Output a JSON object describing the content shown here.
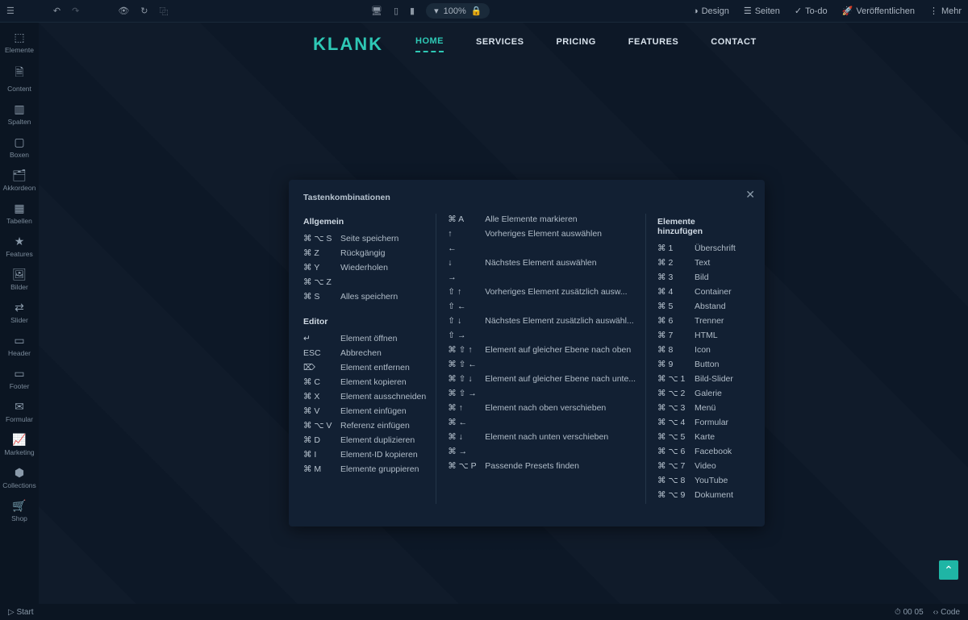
{
  "topbar": {
    "zoom": "100%",
    "design": "Design",
    "seiten": "Seiten",
    "todo": "To-do",
    "publish": "Veröffentlichen",
    "more": "Mehr"
  },
  "sidebar": [
    {
      "icon": "⬚",
      "label": "Elemente"
    },
    {
      "icon": "🗎",
      "label": "Content"
    },
    {
      "icon": "▥",
      "label": "Spalten"
    },
    {
      "icon": "▢",
      "label": "Boxen"
    },
    {
      "icon": "🗂",
      "label": "Akkordeon"
    },
    {
      "icon": "▦",
      "label": "Tabellen"
    },
    {
      "icon": "★",
      "label": "Features"
    },
    {
      "icon": "🖼",
      "label": "Bilder"
    },
    {
      "icon": "⇄",
      "label": "Slider"
    },
    {
      "icon": "▭",
      "label": "Header"
    },
    {
      "icon": "▭",
      "label": "Footer"
    },
    {
      "icon": "✉",
      "label": "Formular"
    },
    {
      "icon": "📈",
      "label": "Marketing"
    },
    {
      "icon": "⬢",
      "label": "Collections"
    },
    {
      "icon": "🛒",
      "label": "Shop"
    }
  ],
  "site": {
    "brand": "KLANK",
    "nav": [
      "HOME",
      "SERVICES",
      "PRICING",
      "FEATURES",
      "CONTACT"
    ]
  },
  "modal": {
    "title": "Tastenkombinationen",
    "col1": {
      "h1": "Allgemein",
      "rows1": [
        {
          "sc": "⌘ ⌥ S",
          "desc": "Seite speichern"
        },
        {
          "sc": "⌘ Z",
          "desc": "Rückgängig"
        },
        {
          "sc": "⌘ Y",
          "desc": "Wiederholen"
        },
        {
          "sc": "⌘ ⌥ Z",
          "desc": ""
        },
        {
          "sc": "⌘ S",
          "desc": "Alles speichern"
        }
      ],
      "h2": "Editor",
      "rows2": [
        {
          "sc": "↵",
          "desc": "Element öffnen"
        },
        {
          "sc": "ESC",
          "desc": "Abbrechen"
        },
        {
          "sc": "⌦",
          "desc": "Element entfernen"
        },
        {
          "sc": "⌘ C",
          "desc": "Element kopieren"
        },
        {
          "sc": "⌘ X",
          "desc": "Element ausschneiden"
        },
        {
          "sc": "⌘ V",
          "desc": "Element einfügen"
        },
        {
          "sc": "⌘ ⌥ V",
          "desc": "Referenz einfügen"
        },
        {
          "sc": "⌘ D",
          "desc": "Element duplizieren"
        },
        {
          "sc": "⌘ I",
          "desc": "Element-ID kopieren"
        },
        {
          "sc": "⌘ M",
          "desc": "Elemente gruppieren"
        }
      ]
    },
    "col2": {
      "rows": [
        {
          "sc": "⌘ A",
          "desc": "Alle Elemente markieren"
        },
        {
          "sc": "↑",
          "desc": "Vorheriges Element auswählen"
        },
        {
          "sc": "←",
          "desc": ""
        },
        {
          "sc": "↓",
          "desc": "Nächstes Element auswählen"
        },
        {
          "sc": "→",
          "desc": ""
        },
        {
          "sc": "⇧ ↑",
          "desc": "Vorheriges Element zusätzlich ausw..."
        },
        {
          "sc": "⇧ ←",
          "desc": ""
        },
        {
          "sc": "⇧ ↓",
          "desc": "Nächstes Element zusätzlich auswähl..."
        },
        {
          "sc": "⇧ →",
          "desc": ""
        },
        {
          "sc": "⌘ ⇧ ↑",
          "desc": "Element auf gleicher Ebene nach oben"
        },
        {
          "sc": "⌘ ⇧ ←",
          "desc": ""
        },
        {
          "sc": "⌘ ⇧ ↓",
          "desc": "Element auf gleicher Ebene nach unte..."
        },
        {
          "sc": "⌘ ⇧ →",
          "desc": ""
        },
        {
          "sc": "⌘ ↑",
          "desc": "Element nach oben verschieben"
        },
        {
          "sc": "⌘ ←",
          "desc": ""
        },
        {
          "sc": "⌘ ↓",
          "desc": "Element nach unten verschieben"
        },
        {
          "sc": "⌘ →",
          "desc": ""
        },
        {
          "sc": "⌘ ⌥ P",
          "desc": "Passende Presets finden"
        }
      ]
    },
    "col3": {
      "h": "Elemente hinzufügen",
      "rows": [
        {
          "sc": "⌘ 1",
          "desc": "Überschrift"
        },
        {
          "sc": "⌘ 2",
          "desc": "Text"
        },
        {
          "sc": "⌘ 3",
          "desc": "Bild"
        },
        {
          "sc": "⌘ 4",
          "desc": "Container"
        },
        {
          "sc": "⌘ 5",
          "desc": "Abstand"
        },
        {
          "sc": "⌘ 6",
          "desc": "Trenner"
        },
        {
          "sc": "⌘ 7",
          "desc": "HTML"
        },
        {
          "sc": "⌘ 8",
          "desc": "Icon"
        },
        {
          "sc": "⌘ 9",
          "desc": "Button"
        },
        {
          "sc": "⌘ ⌥ 1",
          "desc": "Bild-Slider"
        },
        {
          "sc": "⌘ ⌥ 2",
          "desc": "Galerie"
        },
        {
          "sc": "⌘ ⌥ 3",
          "desc": "Menü"
        },
        {
          "sc": "⌘ ⌥ 4",
          "desc": "Formular"
        },
        {
          "sc": "⌘ ⌥ 5",
          "desc": "Karte"
        },
        {
          "sc": "⌘ ⌥ 6",
          "desc": "Facebook"
        },
        {
          "sc": "⌘ ⌥ 7",
          "desc": "Video"
        },
        {
          "sc": "⌘ ⌥ 8",
          "desc": "YouTube"
        },
        {
          "sc": "⌘ ⌥ 9",
          "desc": "Dokument"
        }
      ]
    }
  },
  "bottombar": {
    "start": "Start",
    "time": "00 05",
    "code": "Code"
  }
}
